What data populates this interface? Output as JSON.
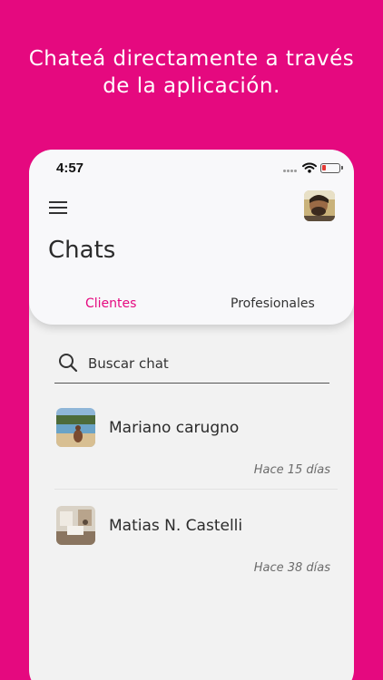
{
  "promo": {
    "line1": "Chateá directamente a través",
    "line2": "de la aplicación."
  },
  "status_bar": {
    "time": "4:57"
  },
  "header": {
    "title": "Chats"
  },
  "tabs": [
    {
      "label": "Clientes",
      "selected": true
    },
    {
      "label": "Profesionales",
      "selected": false
    }
  ],
  "search": {
    "placeholder": "Buscar chat"
  },
  "chats": [
    {
      "name": "Mariano carugno",
      "time": "Hace 15 días"
    },
    {
      "name": "Matias N. Castelli",
      "time": "Hace 38 días"
    }
  ],
  "colors": {
    "brand": "#e5097f",
    "background": "#f2f2f2"
  },
  "icons": {
    "menu": "hamburger-menu-icon",
    "search": "search-icon",
    "wifi": "wifi-icon",
    "battery": "battery-icon"
  }
}
